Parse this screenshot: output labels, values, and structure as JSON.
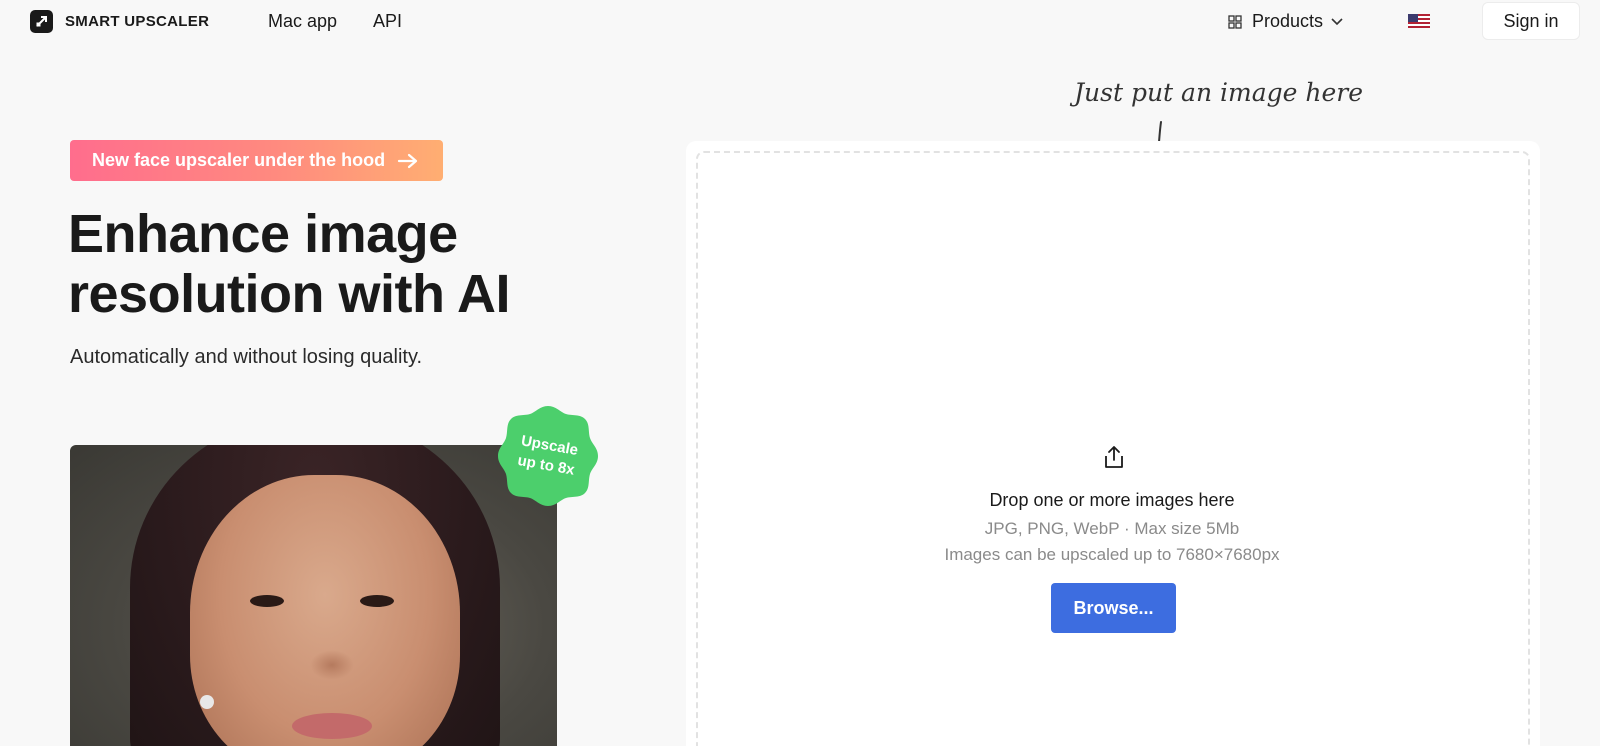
{
  "header": {
    "brand": "SMART UPSCALER",
    "nav": [
      {
        "label": "Mac app"
      },
      {
        "label": "API"
      }
    ],
    "products_label": "Products",
    "sign_in_label": "Sign in"
  },
  "hero": {
    "promo_label": "New face upscaler under the hood",
    "headline_line1": "Enhance image",
    "headline_line2": "resolution with AI",
    "subtitle": "Automatically and without losing quality.",
    "badge_line1": "Upscale",
    "badge_line2": "up to 8x"
  },
  "dropzone": {
    "hint": "Just put an image here",
    "title": "Drop one or more images here",
    "formats": "JPG, PNG, WebP · Max size 5Mb",
    "limit": "Images can be upscaled up to 7680×7680px",
    "browse_label": "Browse..."
  },
  "colors": {
    "accent": "#3d6de0",
    "badge": "#4ccf6c",
    "promo_start": "#ff6d8d",
    "promo_end": "#ffae72"
  },
  "icons": [
    "logo-icon",
    "grid-icon",
    "chevron-down-icon",
    "us-flag-icon",
    "arrow-right-icon",
    "upload-icon",
    "hand-drawn-arrow-icon"
  ]
}
